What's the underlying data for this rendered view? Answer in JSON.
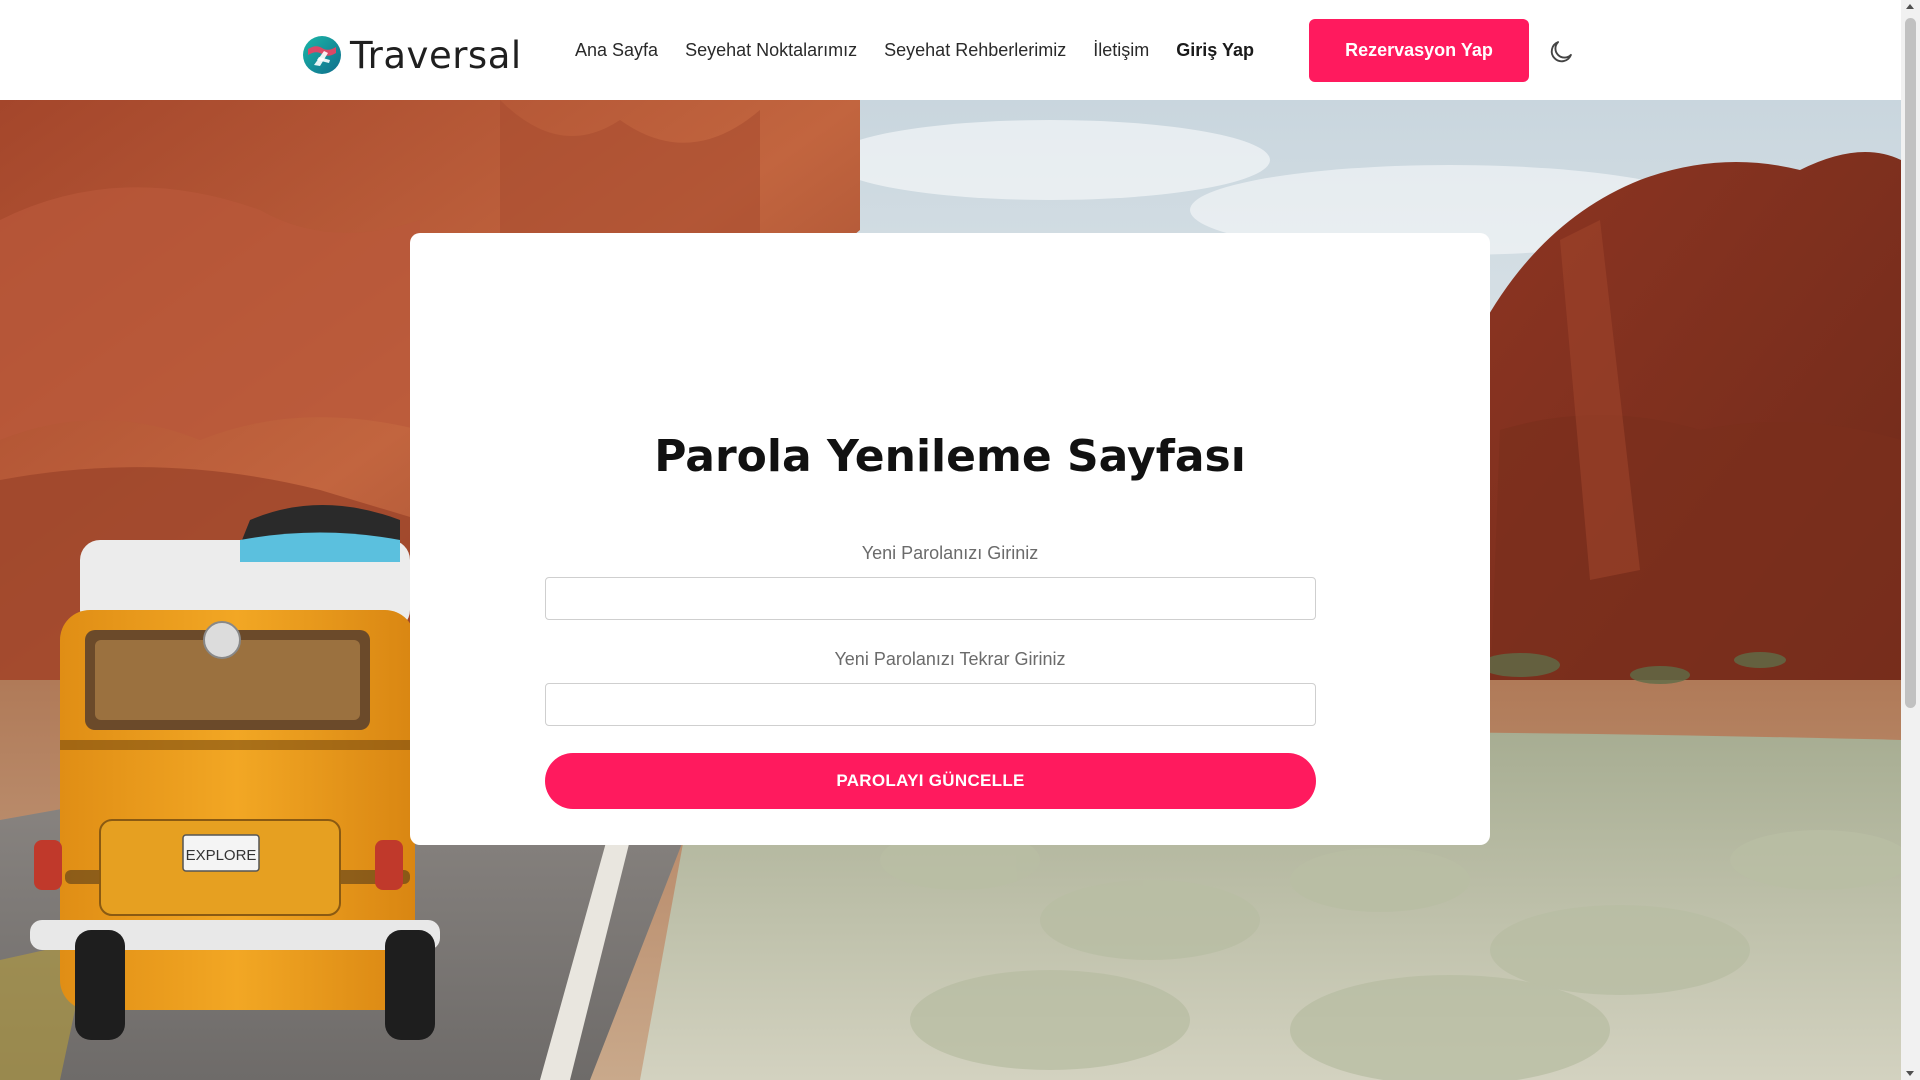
{
  "header": {
    "logo_text": "Traversal",
    "nav": [
      {
        "label": "Ana Sayfa"
      },
      {
        "label": "Seyehat Noktalarımız"
      },
      {
        "label": "Seyehat Rehberlerimiz"
      },
      {
        "label": "İletişim"
      },
      {
        "label": "Giriş Yap"
      }
    ],
    "book_button": "Rezervasyon Yap",
    "theme_icon": "moon-icon"
  },
  "van_plate": "EXPLORE",
  "form": {
    "title": "Parola Yenileme Sayfası",
    "new_password_label": "Yeni Parolanızı Giriniz",
    "new_password_value": "",
    "confirm_password_label": "Yeni Parolanızı Tekrar Giriniz",
    "confirm_password_value": "",
    "submit_label": "PAROLAYI GÜNCELLE"
  },
  "colors": {
    "accent": "#ff1a5e",
    "text": "#111111"
  }
}
